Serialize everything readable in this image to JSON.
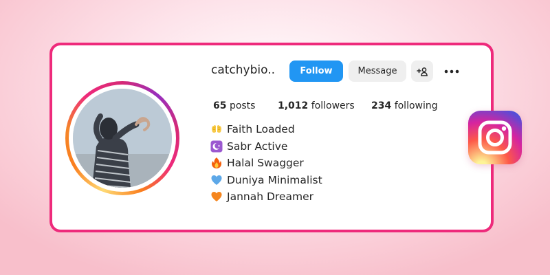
{
  "profile": {
    "username": "catchybio..",
    "follow_label": "Follow",
    "message_label": "Message",
    "add_user_icon": "add-user-icon",
    "more_icon": "more-dots-icon"
  },
  "stats": {
    "posts_count": "65",
    "posts_label": "posts",
    "followers_count": "1,012",
    "followers_label": "followers",
    "following_count": "234",
    "following_label": "following"
  },
  "bio": [
    {
      "emoji": "open-hands",
      "text": "Faith Loaded"
    },
    {
      "emoji": "crescent-moon",
      "text": "Sabr Active"
    },
    {
      "emoji": "fire",
      "text": "Halal Swagger"
    },
    {
      "emoji": "blue-heart",
      "text": "Duniya Minimalist"
    },
    {
      "emoji": "orange-heart",
      "text": "Jannah Dreamer"
    }
  ],
  "colors": {
    "card_border": "#ee2a7b",
    "follow_button": "#2196f3",
    "secondary_button": "#efefef"
  }
}
